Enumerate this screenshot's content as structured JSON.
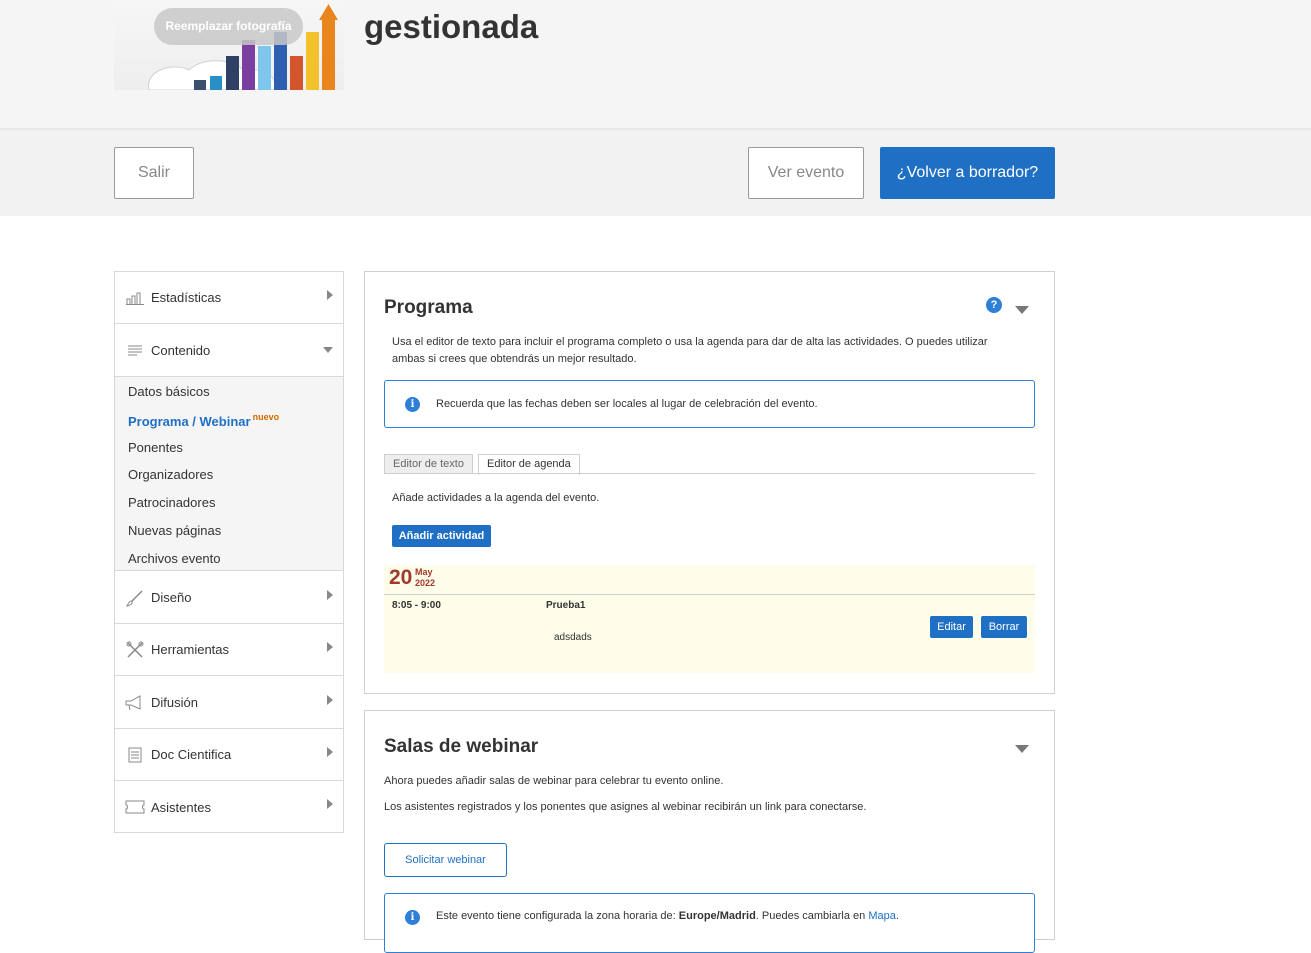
{
  "header": {
    "replace_photo_label": "Reemplazar fotografía",
    "event_title": "gestionada"
  },
  "actions": {
    "exit_label": "Salir",
    "view_event_label": "Ver evento",
    "back_to_draft_label": "¿Volver a borrador?"
  },
  "sidebar": {
    "items": [
      {
        "label": "Estadísticas",
        "icon": "bar-chart-icon"
      },
      {
        "label": "Contenido",
        "icon": "content-icon"
      },
      {
        "label": "Diseño",
        "icon": "brush-icon"
      },
      {
        "label": "Herramientas",
        "icon": "tools-icon"
      },
      {
        "label": "Difusión",
        "icon": "megaphone-icon"
      },
      {
        "label": "Doc Cientifica",
        "icon": "document-icon"
      },
      {
        "label": "Asistentes",
        "icon": "ticket-icon"
      }
    ],
    "submenu": [
      {
        "label": "Datos básicos"
      },
      {
        "label": "Programa / Webinar",
        "badge": "nuevo"
      },
      {
        "label": "Ponentes"
      },
      {
        "label": "Organizadores"
      },
      {
        "label": "Patrocinadores"
      },
      {
        "label": "Nuevas páginas"
      },
      {
        "label": "Archivos evento"
      }
    ]
  },
  "programa": {
    "title": "Programa",
    "help": "?",
    "description": "Usa el editor de texto para incluir el programa completo o usa la agenda para dar de alta las actividades. O puedes utilizar ambas si crees que obtendrás un mejor resultado.",
    "info": "Recuerda que las fechas deben ser locales al lugar de celebración del evento.",
    "tabs": [
      "Editor de texto",
      "Editor de agenda"
    ],
    "agenda_hint": "Añade actividades a la agenda del evento.",
    "add_activity_label": "Añadir actividad",
    "agenda": {
      "day": "20",
      "month": "May",
      "year": "2022",
      "time": "8:05 - 9:00",
      "name": "Prueba1",
      "description": "adsdads",
      "edit_label": "Editar",
      "delete_label": "Borrar"
    }
  },
  "salas": {
    "title": "Salas de webinar",
    "line1": "Ahora puedes añadir salas de webinar para celebrar tu evento online.",
    "line2": "Los asistentes registrados y los ponentes que asignes al webinar recibirán un link para conectarse.",
    "request_label": "Solicitar webinar",
    "tz_prefix": "Este evento tiene configurada la zona horaria de: ",
    "tz_value": "Europe/Madrid",
    "tz_middle": ". Puedes cambiarla en ",
    "tz_link": "Mapa",
    "tz_suffix": "."
  },
  "colors": {
    "primary": "#1f6fc5",
    "info": "#2e7fd8",
    "badge": "#d26a00",
    "agenda_date": "#a0392b",
    "agenda_bg": "#fdfde9"
  }
}
